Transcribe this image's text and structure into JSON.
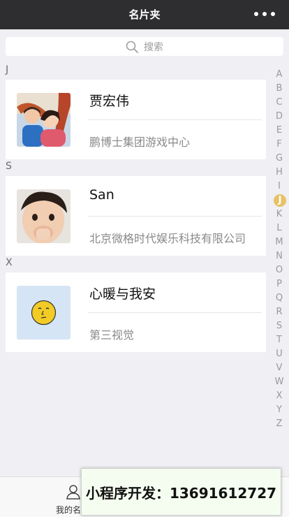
{
  "header": {
    "title": "名片夹",
    "more_icon": "more-dots-icon"
  },
  "search": {
    "placeholder": "搜索",
    "icon": "search-icon"
  },
  "sections": [
    {
      "letter": "J",
      "contact": {
        "name": "贾宏伟",
        "company": "鹏博士集团游戏中心",
        "avatar": "family-photo"
      }
    },
    {
      "letter": "S",
      "contact": {
        "name": "San",
        "company": "北京微格时代娱乐科技有限公司",
        "avatar": "child-photo"
      }
    },
    {
      "letter": "X",
      "contact": {
        "name": "心暖与我安",
        "company": "第三视觉",
        "avatar": "emoji-face"
      }
    }
  ],
  "index": {
    "letters": [
      "A",
      "B",
      "C",
      "D",
      "E",
      "F",
      "G",
      "H",
      "I",
      "J",
      "K",
      "L",
      "M",
      "N",
      "O",
      "P",
      "Q",
      "R",
      "S",
      "T",
      "U",
      "V",
      "W",
      "X",
      "Y",
      "Z"
    ],
    "active": "J",
    "active_color": "#e8c166"
  },
  "tabbar": {
    "my_card_label": "我的名",
    "icon": "person-icon"
  },
  "promo": {
    "text": "小程序开发：13691612727"
  }
}
